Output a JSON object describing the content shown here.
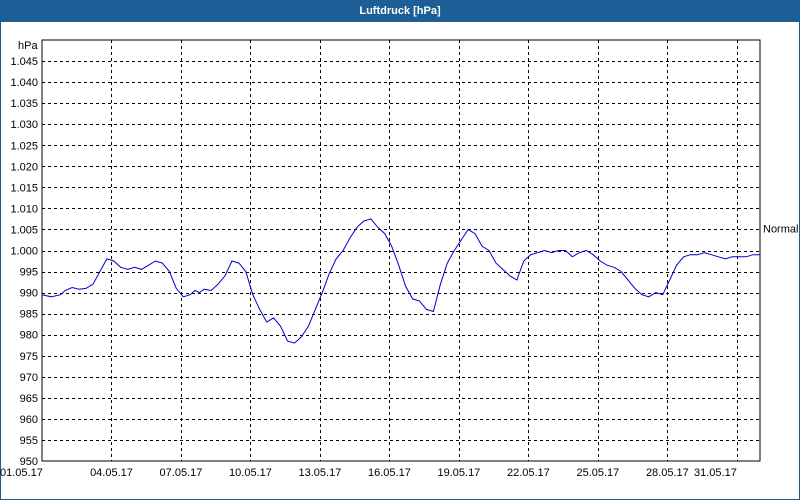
{
  "window": {
    "title": "Luftdruck [hPa]"
  },
  "chart_data": {
    "type": "line",
    "title": "Luftdruck [hPa]",
    "ylabel": "hPa",
    "xlabel": "",
    "ylim": [
      950,
      1050
    ],
    "grid": true,
    "yticks": [
      "950",
      "955",
      "960",
      "965",
      "970",
      "975",
      "980",
      "985",
      "990",
      "995",
      "1.000",
      "1.005",
      "1.010",
      "1.015",
      "1.020",
      "1.025",
      "1.030",
      "1.035",
      "1.040",
      "1.045"
    ],
    "yticks_values": [
      950,
      955,
      960,
      965,
      970,
      975,
      980,
      985,
      990,
      995,
      1000,
      1005,
      1010,
      1015,
      1020,
      1025,
      1030,
      1035,
      1040,
      1045
    ],
    "xticks": [
      "01.05.17",
      "04.05.17",
      "07.05.17",
      "10.05.17",
      "13.05.17",
      "16.05.17",
      "19.05.17",
      "22.05.17",
      "25.05.17",
      "28.05.17",
      "31.05.17"
    ],
    "xlim_days": [
      0,
      31
    ],
    "reference_line": {
      "label": "Normal",
      "value": 1004.5
    },
    "series": [
      {
        "color": "#0000cc",
        "x": [
          0,
          0.4,
          0.8,
          1.0,
          1.3,
          1.6,
          1.9,
          2.2,
          2.5,
          2.8,
          3.1,
          3.4,
          3.7,
          4.0,
          4.3,
          4.6,
          4.9,
          5.2,
          5.5,
          5.8,
          6.1,
          6.4,
          6.6,
          6.8,
          7.0,
          7.3,
          7.6,
          7.9,
          8.2,
          8.5,
          8.8,
          9.1,
          9.4,
          9.7,
          10.0,
          10.3,
          10.6,
          10.9,
          11.2,
          11.5,
          11.8,
          12.1,
          12.4,
          12.7,
          13.0,
          13.3,
          13.6,
          13.9,
          14.2,
          14.5,
          14.8,
          15.1,
          15.4,
          15.7,
          16.0,
          16.3,
          16.6,
          16.9,
          17.2,
          17.5,
          17.8,
          18.1,
          18.4,
          18.7,
          19.0,
          19.3,
          19.6,
          19.9,
          20.2,
          20.5,
          20.8,
          21.1,
          21.4,
          21.7,
          22.0,
          22.3,
          22.6,
          22.9,
          23.2,
          23.5,
          23.8,
          24.1,
          24.4,
          24.7,
          25.0,
          25.3,
          25.6,
          25.9,
          26.2,
          26.5,
          26.8,
          27.1,
          27.4,
          27.7,
          28.0,
          28.3,
          28.6,
          28.9,
          29.2,
          29.5,
          29.8,
          30.1,
          30.4,
          30.7,
          31.0
        ],
        "y": [
          989.5,
          989.0,
          989.5,
          990.5,
          991.2,
          990.8,
          991.0,
          992.0,
          995.0,
          998.0,
          997.5,
          996.0,
          995.5,
          996.0,
          995.5,
          996.5,
          997.5,
          997.0,
          995.0,
          991.0,
          989.0,
          989.5,
          990.5,
          990.0,
          990.8,
          990.5,
          992.0,
          994.0,
          997.5,
          997.0,
          995.0,
          989.5,
          986.0,
          983.0,
          984.0,
          982.0,
          978.5,
          978.0,
          979.5,
          982.0,
          986.0,
          990.0,
          994.5,
          998.0,
          1000.0,
          1003.0,
          1005.5,
          1007.0,
          1007.5,
          1005.5,
          1004.0,
          1001.0,
          996.5,
          991.5,
          988.5,
          988.0,
          986.0,
          985.5,
          992.0,
          997.0,
          1000.0,
          1002.5,
          1005.0,
          1004.0,
          1001.0,
          1000.0,
          997.0,
          995.5,
          994.0,
          993.0,
          997.5,
          999.0,
          999.5,
          1000.0,
          999.5,
          1000.0,
          1000.0,
          998.5,
          999.5,
          1000.0,
          999.0,
          997.5,
          996.5,
          996.0,
          995.0,
          993.0,
          991.0,
          989.5,
          989.0,
          990.0,
          989.5,
          993.0,
          996.5,
          998.5,
          999.0,
          999.0,
          999.5,
          999.0,
          998.5,
          998.0,
          998.5,
          998.5,
          998.5,
          999.0,
          999.0
        ]
      }
    ]
  }
}
